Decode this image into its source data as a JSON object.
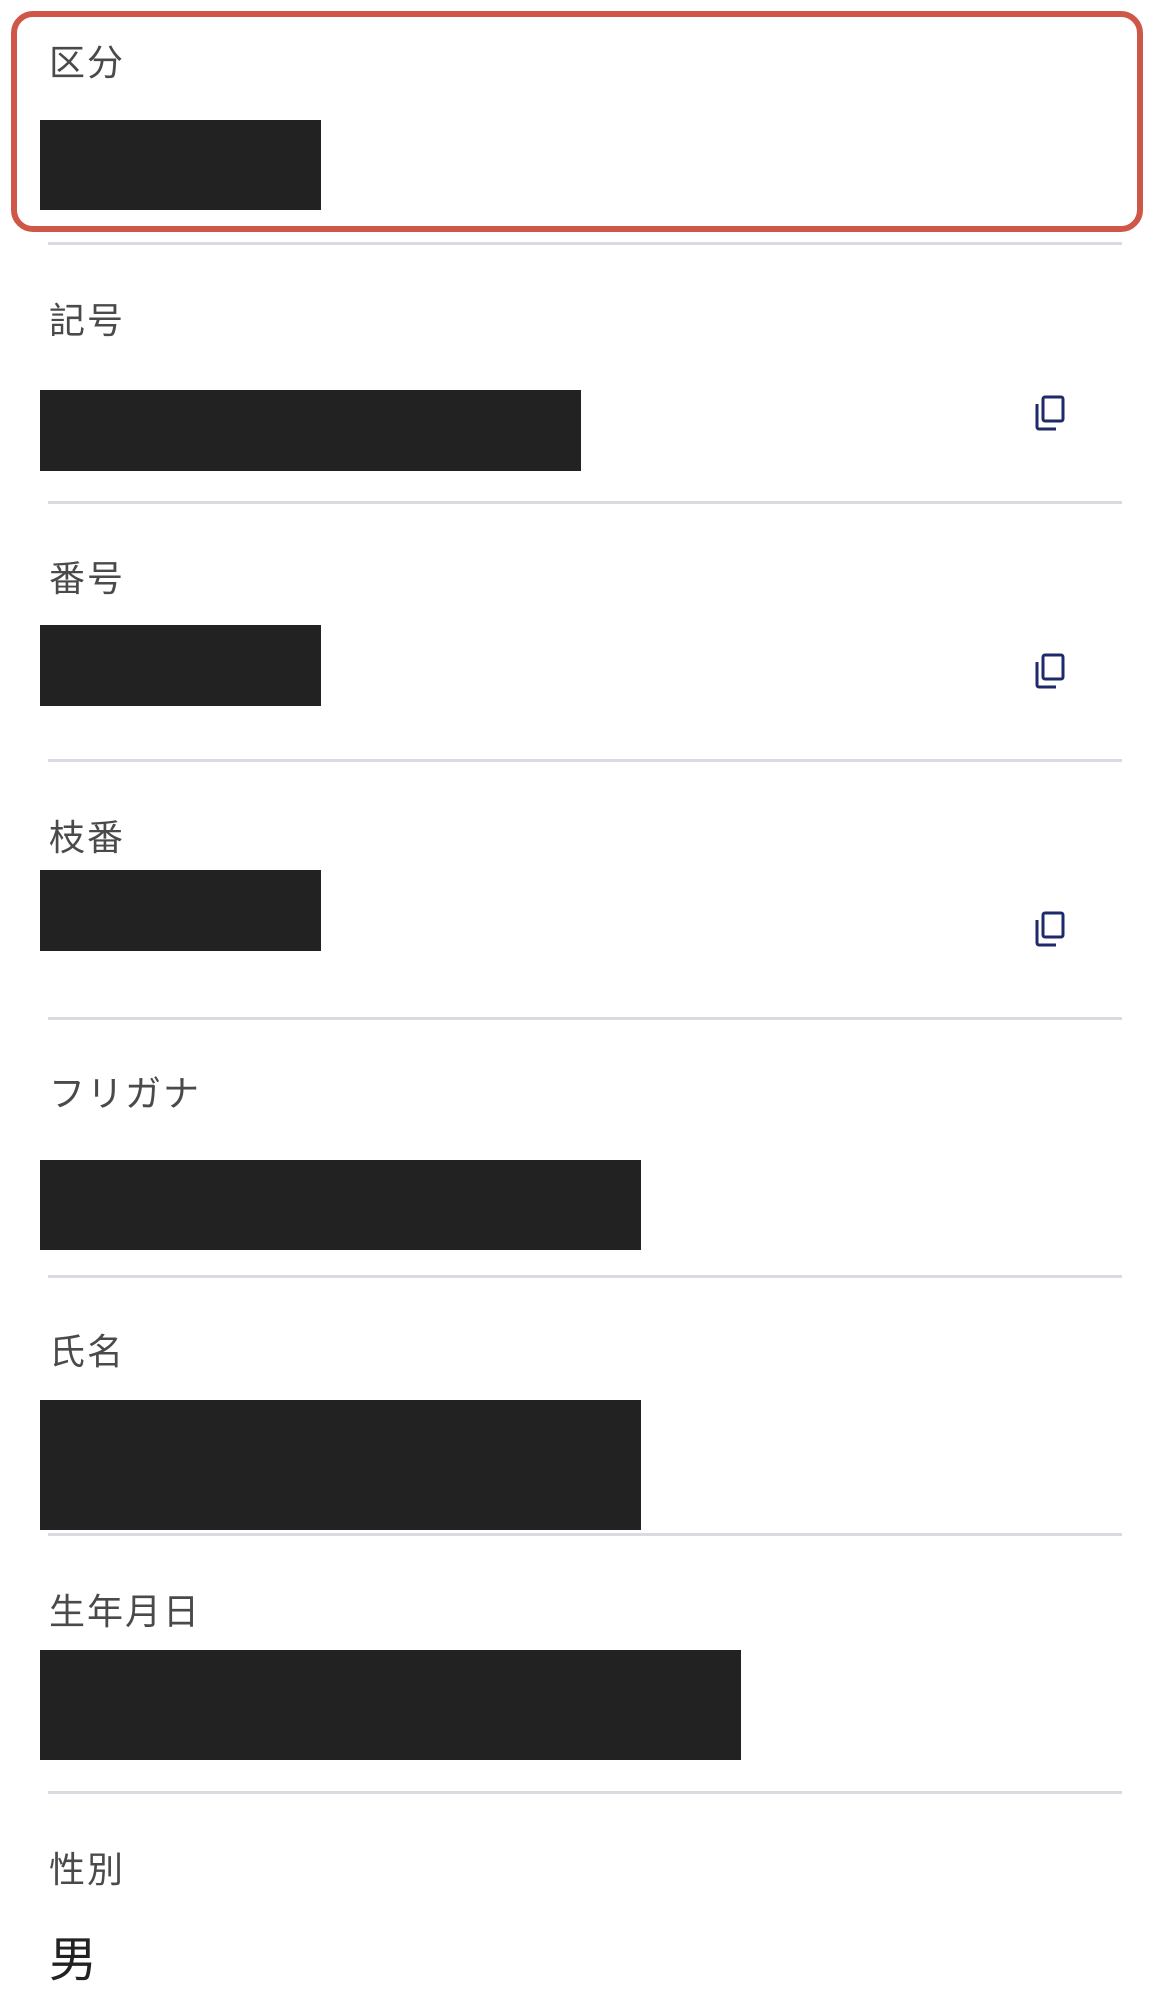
{
  "fields": [
    {
      "label": "区分"
    },
    {
      "label": "記号"
    },
    {
      "label": "番号"
    },
    {
      "label": "枝番"
    },
    {
      "label": "フリガナ"
    },
    {
      "label": "氏名"
    },
    {
      "label": "生年月日"
    },
    {
      "label": "性別",
      "value": "男"
    }
  ],
  "colors": {
    "highlight_border": "#cf5748",
    "divider": "#dadbe0",
    "redaction": "#222222",
    "copy_icon": "#1f2a6b"
  },
  "icons": {
    "copy": "copy-icon"
  }
}
